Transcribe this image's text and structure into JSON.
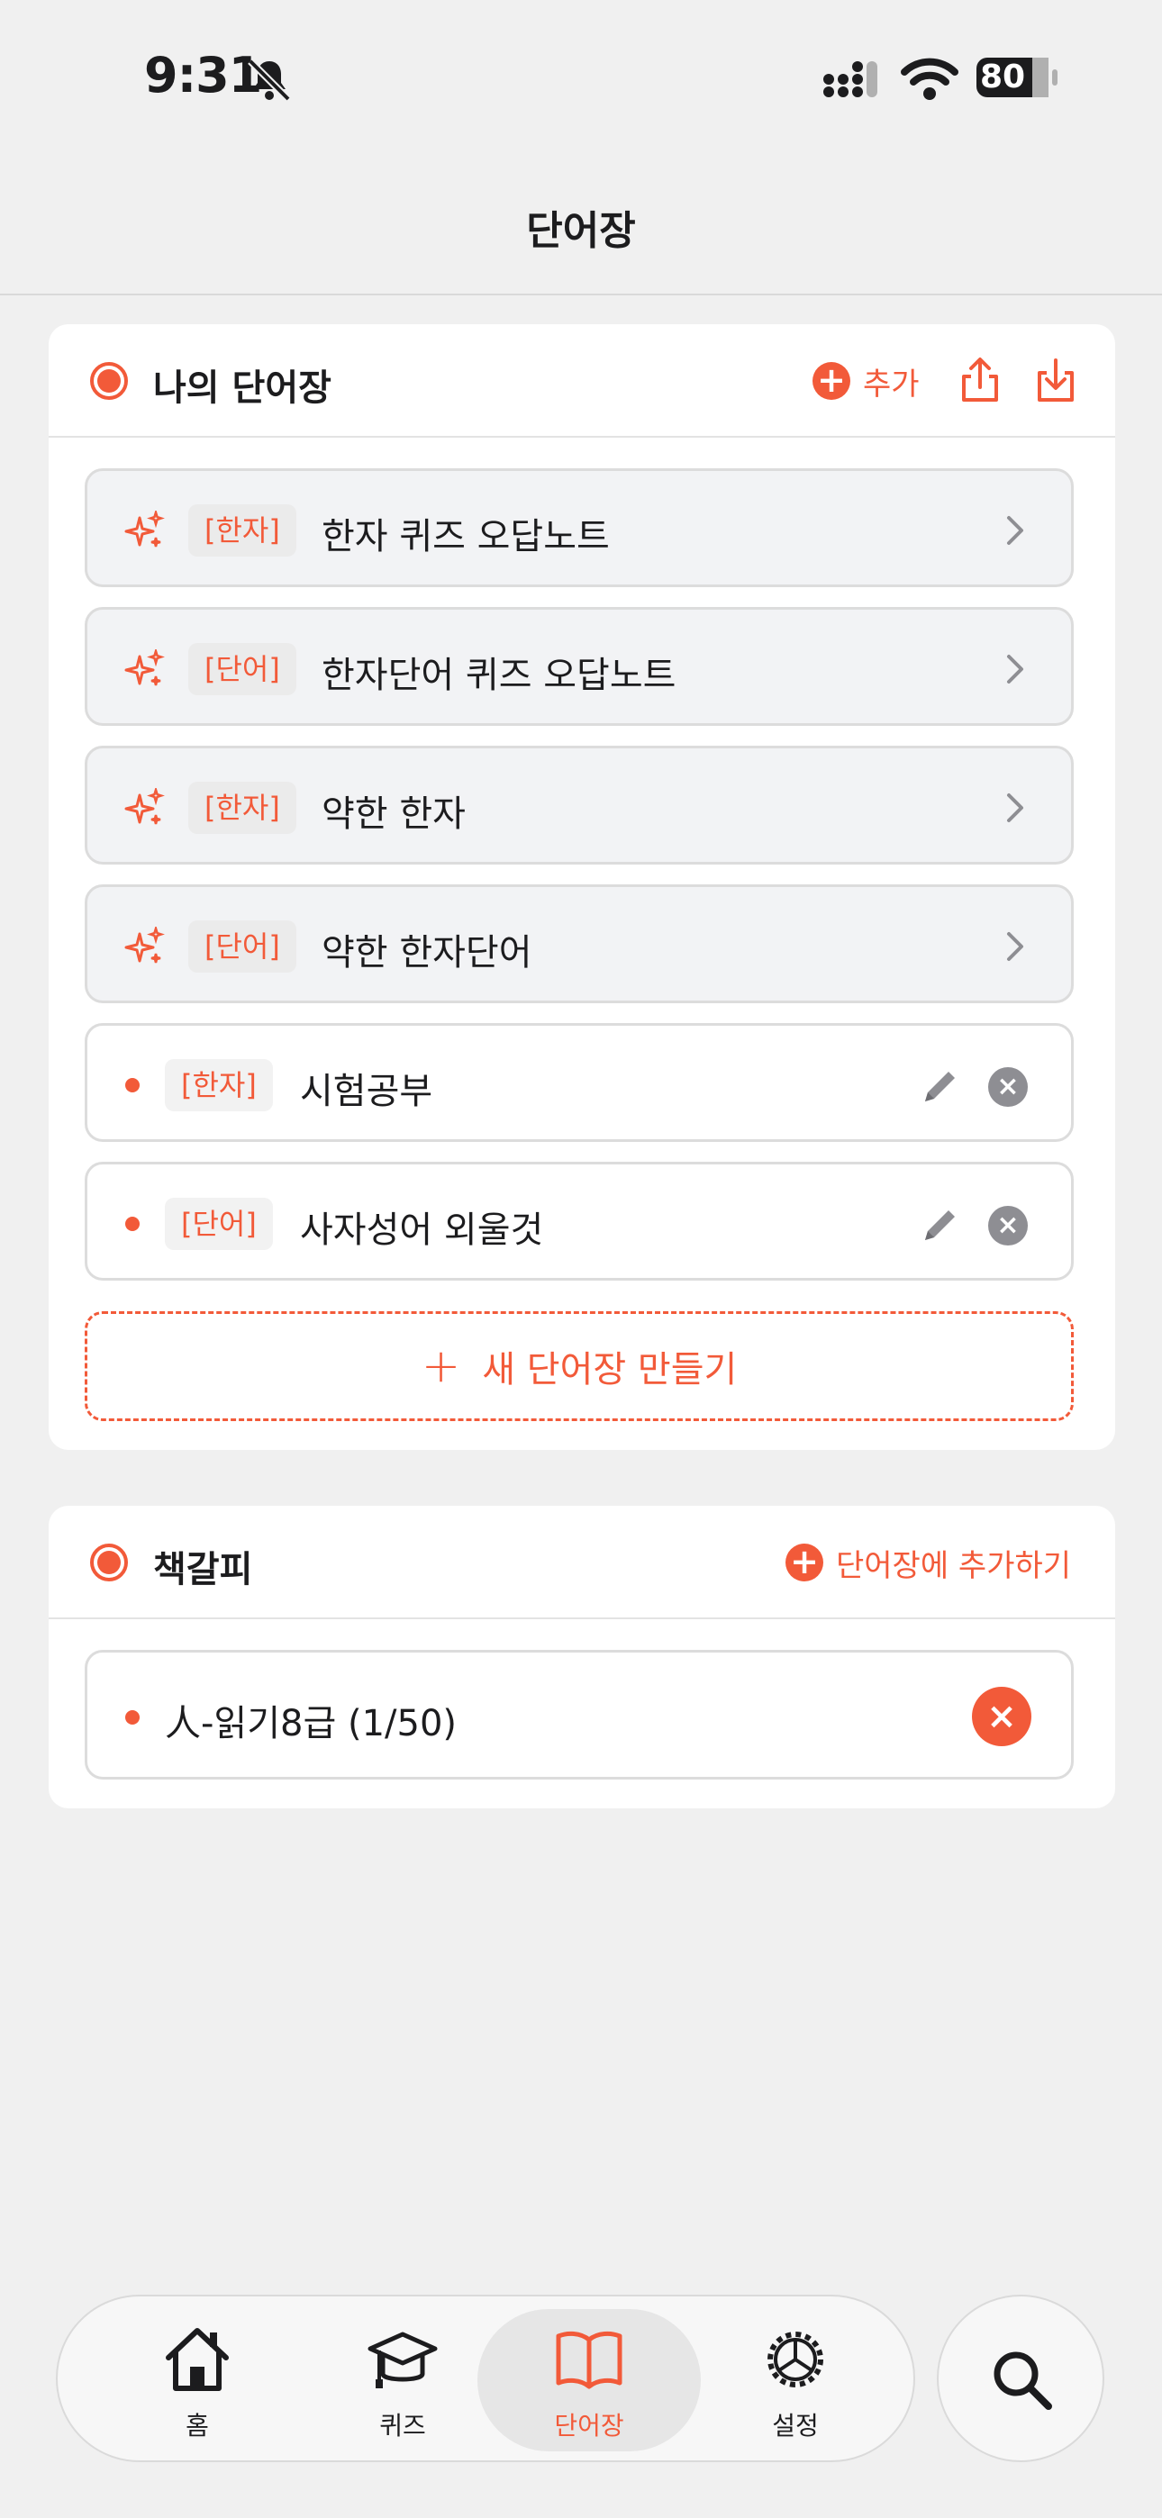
{
  "status": {
    "time": "9:31",
    "battery": "80"
  },
  "nav": {
    "title": "단어장"
  },
  "my_books": {
    "title": "나의 단어장",
    "add_label": "추가",
    "smart_lists": [
      {
        "tag": "[한자]",
        "label": "한자 퀴즈 오답노트"
      },
      {
        "tag": "[단어]",
        "label": "한자단어 퀴즈 오답노트"
      },
      {
        "tag": "[한자]",
        "label": "약한 한자"
      },
      {
        "tag": "[단어]",
        "label": "약한 한자단어"
      }
    ],
    "custom_lists": [
      {
        "tag": "[한자]",
        "label": "시험공부"
      },
      {
        "tag": "[단어]",
        "label": "사자성어 외울것"
      }
    ],
    "new_book_label": "새 단어장 만들기"
  },
  "bookmarks": {
    "title": "책갈피",
    "add_label": "단어장에 추가하기",
    "items": [
      {
        "label": "人-읽기8급 (1/50)"
      }
    ]
  },
  "tabbar": {
    "tabs": [
      {
        "label": "홈",
        "icon": "house-icon"
      },
      {
        "label": "퀴즈",
        "icon": "graduation-cap-icon"
      },
      {
        "label": "단어장",
        "icon": "book-icon",
        "active": true
      },
      {
        "label": "설정",
        "icon": "gear-icon"
      }
    ],
    "search_icon": "magnifying-glass-icon"
  },
  "colors": {
    "accent": "#f25a39",
    "background": "#f0f0f0",
    "card": "#ffffff",
    "muted_icon": "#8e8e93"
  }
}
